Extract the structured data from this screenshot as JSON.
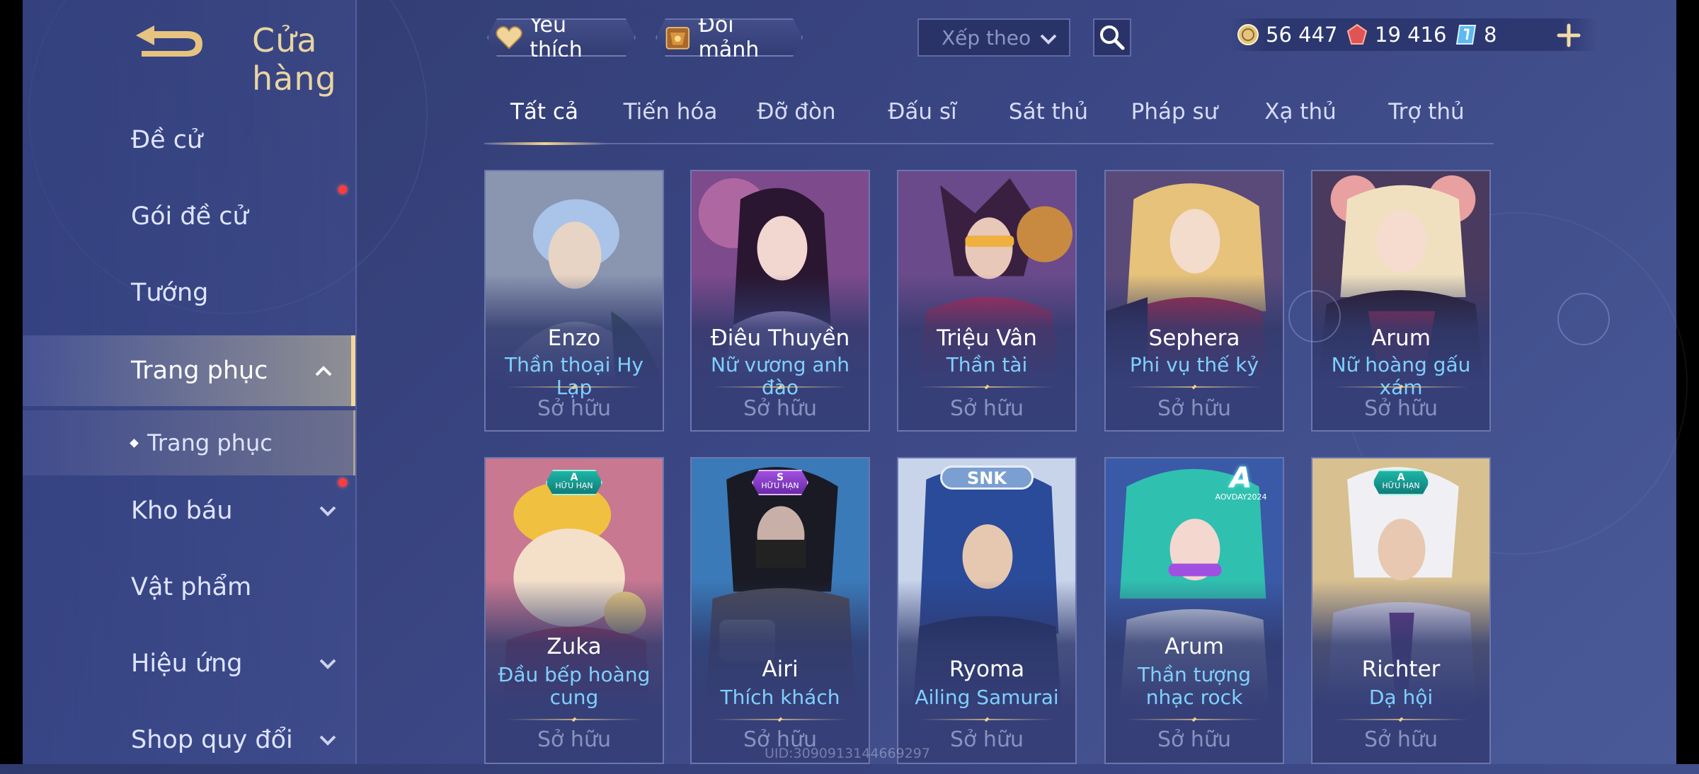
{
  "header": {
    "title": "Cửa hàng",
    "favorites_label": "Yêu thích",
    "exchange_label": "Đổi mảnh",
    "sort_placeholder": "Xếp theo"
  },
  "currencies": [
    {
      "icon": "gold-coin-icon",
      "value": "56 447"
    },
    {
      "icon": "red-gem-icon",
      "value": "19 416"
    },
    {
      "icon": "blue-voucher-icon",
      "value": "8"
    }
  ],
  "sidebar": {
    "items": [
      {
        "label": "Đề cử"
      },
      {
        "label": "Gói đề cử"
      },
      {
        "label": "Tướng"
      },
      {
        "label": "Trang phục"
      },
      {
        "label": "Trang phục"
      },
      {
        "label": "Kho báu"
      },
      {
        "label": "Vật phẩm"
      },
      {
        "label": "Hiệu ứng"
      },
      {
        "label": "Shop quy đổi"
      }
    ]
  },
  "tabs": [
    {
      "label": "Tất cả"
    },
    {
      "label": "Tiến hóa"
    },
    {
      "label": "Đỡ đòn"
    },
    {
      "label": "Đấu sĩ"
    },
    {
      "label": "Sát thủ"
    },
    {
      "label": "Pháp sư"
    },
    {
      "label": "Xạ thủ"
    },
    {
      "label": "Trợ thủ"
    }
  ],
  "cards": [
    {
      "hero": "Enzo",
      "skin": "Thần thoại Hy Lạp",
      "status": "Sở hữu"
    },
    {
      "hero": "Điêu Thuyền",
      "skin": "Nữ vương anh đào",
      "status": "Sở hữu"
    },
    {
      "hero": "Triệu Vân",
      "skin": "Thần tài",
      "status": "Sở hữu"
    },
    {
      "hero": "Sephera",
      "skin": "Phi vụ thế kỷ",
      "status": "Sở hữu"
    },
    {
      "hero": "Arum",
      "skin": "Nữ hoàng gấu xám",
      "status": "Sở hữu"
    },
    {
      "hero": "Zuka",
      "skin": "Đầu bếp hoàng cung",
      "status": "Sở hữu",
      "badge_grade": "A",
      "badge_text": "HỮU HẠN"
    },
    {
      "hero": "Airi",
      "skin": "Thích khách",
      "status": "Sở hữu",
      "badge_grade": "S",
      "badge_text": "HỮU HẠN"
    },
    {
      "hero": "Ryoma",
      "skin": "Ailing Samurai",
      "status": "Sở hữu",
      "badge_text": "SNK"
    },
    {
      "hero": "Arum",
      "skin": "Thần tượng nhạc rock",
      "status": "Sở hữu",
      "badge_grade": "A",
      "badge_text": "AOVDAY2024"
    },
    {
      "hero": "Richter",
      "skin": "Dạ hội",
      "status": "Sở hữu",
      "badge_grade": "A",
      "badge_text": "HỮU HẠN"
    }
  ],
  "footer": {
    "uid": "UID:3090913144669297"
  }
}
